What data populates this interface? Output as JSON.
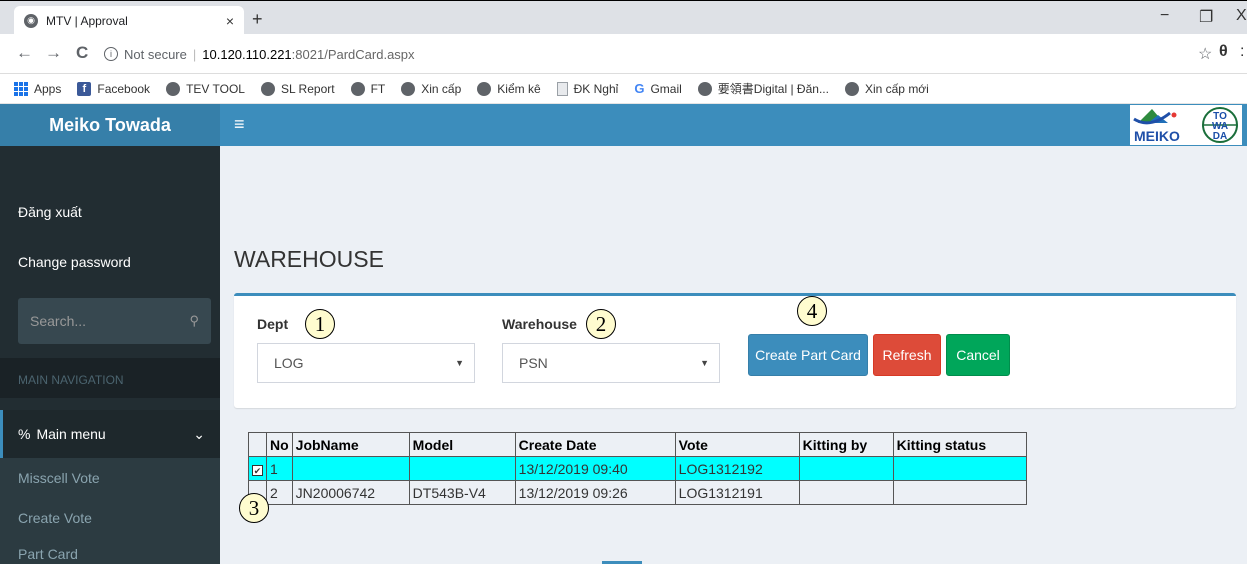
{
  "browser": {
    "tab_title": "MTV | Approval",
    "tab_close": "×",
    "new_tab": "+",
    "win_min": "−",
    "win_restore": "❐",
    "win_close": "X",
    "back": "←",
    "forward": "→",
    "reload": "C",
    "secure_label": "Not secure",
    "separator": "|",
    "url_host": "10.120.110.221",
    "url_path": ":8021/PardCard.aspx",
    "star": "☆",
    "profile": "θ",
    "kebab": ":"
  },
  "bookmarks": [
    {
      "label": "Apps",
      "icon": "apps-icon"
    },
    {
      "label": "Facebook",
      "icon": "facebook-icon"
    },
    {
      "label": "TEV TOOL",
      "icon": "globe-icon"
    },
    {
      "label": "SL Report",
      "icon": "globe-icon"
    },
    {
      "label": "FT",
      "icon": "globe-icon"
    },
    {
      "label": "Xin cấp",
      "icon": "globe-icon"
    },
    {
      "label": "Kiểm kê",
      "icon": "globe-icon"
    },
    {
      "label": "ĐK Nghỉ",
      "icon": "doc-icon"
    },
    {
      "label": "Gmail",
      "icon": "google-icon"
    },
    {
      "label": "要領書Digital | Đăn...",
      "icon": "globe-icon"
    },
    {
      "label": "Xin cấp mới",
      "icon": "globe-icon"
    }
  ],
  "app": {
    "brand": "Meiko Towada",
    "hamburger": "≡",
    "logo": {
      "text_main": "MEIKO",
      "circle_lines": [
        "TO",
        "WA",
        "DA"
      ]
    }
  },
  "sidebar": {
    "logout": "Đăng xuất",
    "change_password": "Change password",
    "search_placeholder": "Search...",
    "nav_header": "MAIN NAVIGATION",
    "main_menu": "Main menu",
    "main_menu_chevron": "⌄",
    "items": [
      "Misscell Vote",
      "Create Vote",
      "Part Card"
    ]
  },
  "page": {
    "title": "WAREHOUSE",
    "dept_label": "Dept",
    "dept_value": "LOG",
    "warehouse_label": "Warehouse",
    "warehouse_value": "PSN",
    "create_btn": "Create Part Card",
    "refresh_btn": "Refresh",
    "cancel_btn": "Cancel",
    "markers": [
      "1",
      "2",
      "3",
      "4"
    ]
  },
  "table": {
    "headers": [
      "",
      "No",
      "JobName",
      "Model",
      "Create Date",
      "Vote",
      "Kitting by",
      "Kitting status"
    ],
    "rows": [
      {
        "checked": true,
        "no": "1",
        "job": "",
        "model": "",
        "date": "13/12/2019 09:40",
        "vote": "LOG1312192",
        "kitting_by": "",
        "status": ""
      },
      {
        "checked": false,
        "no": "2",
        "job": "JN20006742",
        "model": "DT543B-V4",
        "date": "13/12/2019 09:26",
        "vote": "LOG1312191",
        "kitting_by": "",
        "status": ""
      }
    ]
  },
  "colors": {
    "topbar": "#3c8dbc",
    "sidebar": "#222d32",
    "selected_row": "#00ffff",
    "refresh": "#dd4b39",
    "cancel": "#00a65a"
  }
}
